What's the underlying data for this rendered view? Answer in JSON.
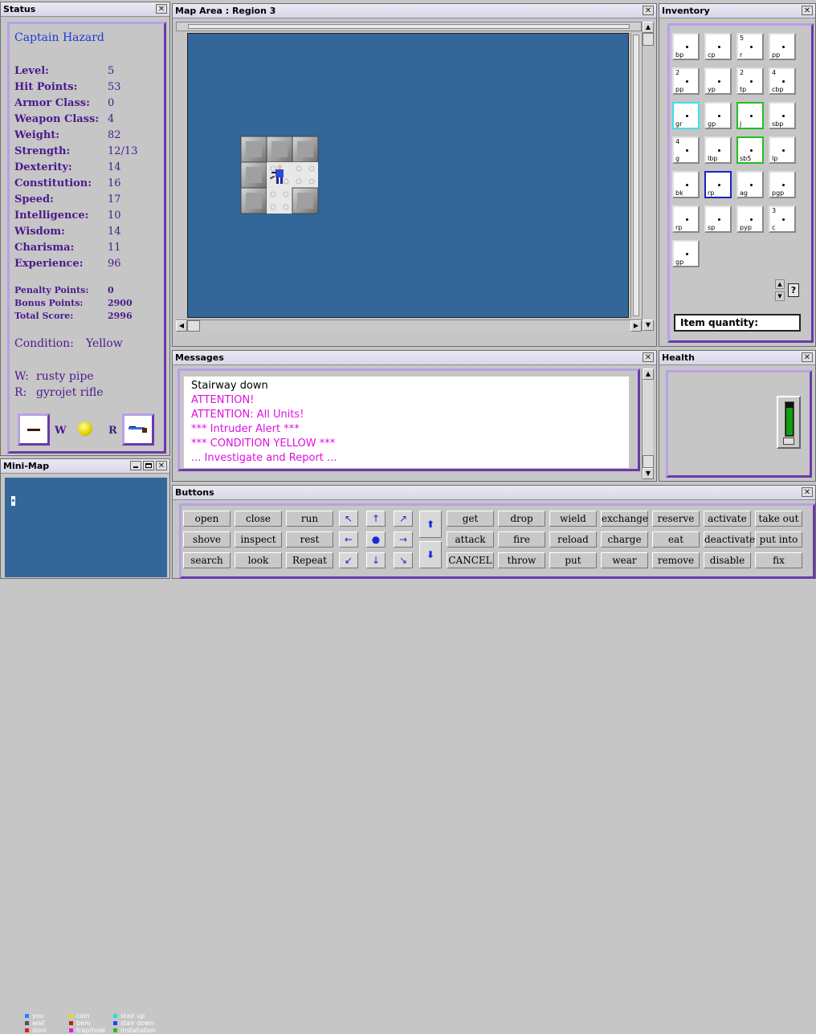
{
  "status": {
    "title": "Status",
    "character_name": "Captain Hazard",
    "stats": [
      {
        "label": "Level:",
        "value": "5"
      },
      {
        "label": "Hit Points:",
        "value": "53"
      },
      {
        "label": "Armor Class:",
        "value": "0"
      },
      {
        "label": "Weapon Class:",
        "value": "4"
      },
      {
        "label": "Weight:",
        "value": "82"
      },
      {
        "label": "Strength:",
        "value": "12/13"
      },
      {
        "label": "Dexterity:",
        "value": "14"
      },
      {
        "label": "Constitution:",
        "value": "16"
      },
      {
        "label": "Speed:",
        "value": "17"
      },
      {
        "label": "Intelligence:",
        "value": "10"
      },
      {
        "label": "Wisdom:",
        "value": "14"
      },
      {
        "label": "Charisma:",
        "value": "11"
      },
      {
        "label": "Experience:",
        "value": "96"
      }
    ],
    "points": [
      {
        "label": "Penalty Points:",
        "value": "0"
      },
      {
        "label": "Bonus Points:",
        "value": "2900"
      },
      {
        "label": "Total Score:",
        "value": "2996"
      }
    ],
    "condition_label": "Condition:",
    "condition_value": "Yellow",
    "weapon_label": "W:",
    "weapon_value": "rusty pipe",
    "ranged_label": "R:",
    "ranged_value": "gyrojet rifle",
    "w_tag": "W",
    "r_tag": "R"
  },
  "map": {
    "title": "Map Area : Region 3"
  },
  "inventory": {
    "title": "Inventory",
    "items": [
      {
        "label": "bp",
        "count": ""
      },
      {
        "label": "cp",
        "count": ""
      },
      {
        "label": "r",
        "count": "5"
      },
      {
        "label": "pp",
        "count": ""
      },
      {
        "label": "pp",
        "count": "2"
      },
      {
        "label": "yp",
        "count": ""
      },
      {
        "label": "tp",
        "count": "2"
      },
      {
        "label": "cbp",
        "count": "4"
      },
      {
        "label": "gr",
        "count": ""
      },
      {
        "label": "gp",
        "count": ""
      },
      {
        "label": "j",
        "count": ""
      },
      {
        "label": "sbp",
        "count": ""
      },
      {
        "label": "g",
        "count": "4"
      },
      {
        "label": "lbp",
        "count": ""
      },
      {
        "label": "sb5",
        "count": ""
      },
      {
        "label": "lp",
        "count": ""
      },
      {
        "label": "bk",
        "count": ""
      },
      {
        "label": "rp",
        "count": ""
      },
      {
        "label": "ag",
        "count": ""
      },
      {
        "label": "pgp",
        "count": ""
      },
      {
        "label": "rp",
        "count": ""
      },
      {
        "label": "sp",
        "count": ""
      },
      {
        "label": "pyp",
        "count": ""
      },
      {
        "label": "c",
        "count": "3"
      },
      {
        "label": "gp",
        "count": ""
      }
    ],
    "quantity_label": "Item quantity:",
    "help": "?"
  },
  "messages": {
    "title": "Messages",
    "lines": [
      {
        "text": "Stairway down",
        "color": "#000000"
      },
      {
        "text": "ATTENTION!",
        "color": "#e010e0"
      },
      {
        "text": "ATTENTION: All Units!",
        "color": "#e010e0"
      },
      {
        "text": "*** Intruder Alert ***",
        "color": "#e010e0"
      },
      {
        "text": "*** CONDITION YELLOW ***",
        "color": "#e010e0"
      },
      {
        "text": "... Investigate and Report ...",
        "color": "#e010e0"
      }
    ]
  },
  "health": {
    "title": "Health",
    "level": 0.85
  },
  "minimap": {
    "title": "Mini-Map",
    "legend": [
      {
        "label": "you",
        "color": "#2080ff"
      },
      {
        "label": "wall",
        "color": "#505050"
      },
      {
        "label": "door",
        "color": "#e02020"
      },
      {
        "label": "coin",
        "color": "#e0e020"
      },
      {
        "label": "bem",
        "color": "#c02020"
      },
      {
        "label": "trap/hole",
        "color": "#e020e0"
      },
      {
        "label": "stair up",
        "color": "#20e0e0"
      },
      {
        "label": "stair down",
        "color": "#2040ff"
      },
      {
        "label": "installation",
        "color": "#20c020"
      }
    ]
  },
  "buttons": {
    "title": "Buttons",
    "left": [
      [
        "open",
        "close",
        "run"
      ],
      [
        "shove",
        "inspect",
        "rest"
      ],
      [
        "search",
        "look",
        "Repeat"
      ]
    ],
    "right": [
      [
        "get",
        "drop",
        "wield",
        "exchange",
        "reserve",
        "activate",
        "take out"
      ],
      [
        "attack",
        "fire",
        "reload",
        "charge",
        "eat",
        "deactivate",
        "put into"
      ],
      [
        "CANCEL",
        "throw",
        "put",
        "wear",
        "remove",
        "disable",
        "fix"
      ]
    ]
  },
  "colors": {
    "map_bg": "#336699",
    "purple": "#4a1a8c",
    "magenta": "#e010e0"
  }
}
